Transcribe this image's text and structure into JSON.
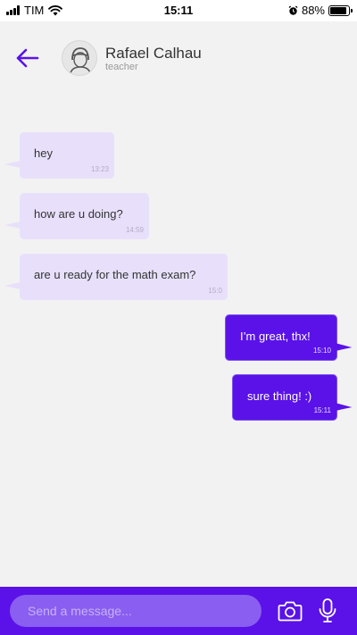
{
  "status_bar": {
    "carrier": "TIM",
    "time": "15:11",
    "battery_percent": "88%",
    "battery_level": 0.88,
    "icons": [
      "signal-icon",
      "wifi-icon",
      "alarm-icon",
      "battery-icon"
    ]
  },
  "header": {
    "back_icon": "arrow-left-icon",
    "contact_name": "Rafael Calhau",
    "contact_role": "teacher",
    "avatar": "avatar-icon"
  },
  "messages": [
    {
      "direction": "incoming",
      "text": "hey",
      "time": "13:23"
    },
    {
      "direction": "incoming",
      "text": "how are u doing?",
      "time": "14:59"
    },
    {
      "direction": "incoming",
      "text": "are u ready for the math exam?",
      "time": "15:0"
    },
    {
      "direction": "outgoing",
      "text": "I’m great, thx!",
      "time": "15:10"
    },
    {
      "direction": "outgoing",
      "text": "sure thing! :)",
      "time": "15:11"
    }
  ],
  "composer": {
    "placeholder": "Send a message...",
    "camera_icon": "camera-icon",
    "mic_icon": "microphone-icon"
  },
  "colors": {
    "accent": "#5a12e8",
    "incoming_bubble": "#e8e0fb",
    "background": "#f2f2f2"
  }
}
